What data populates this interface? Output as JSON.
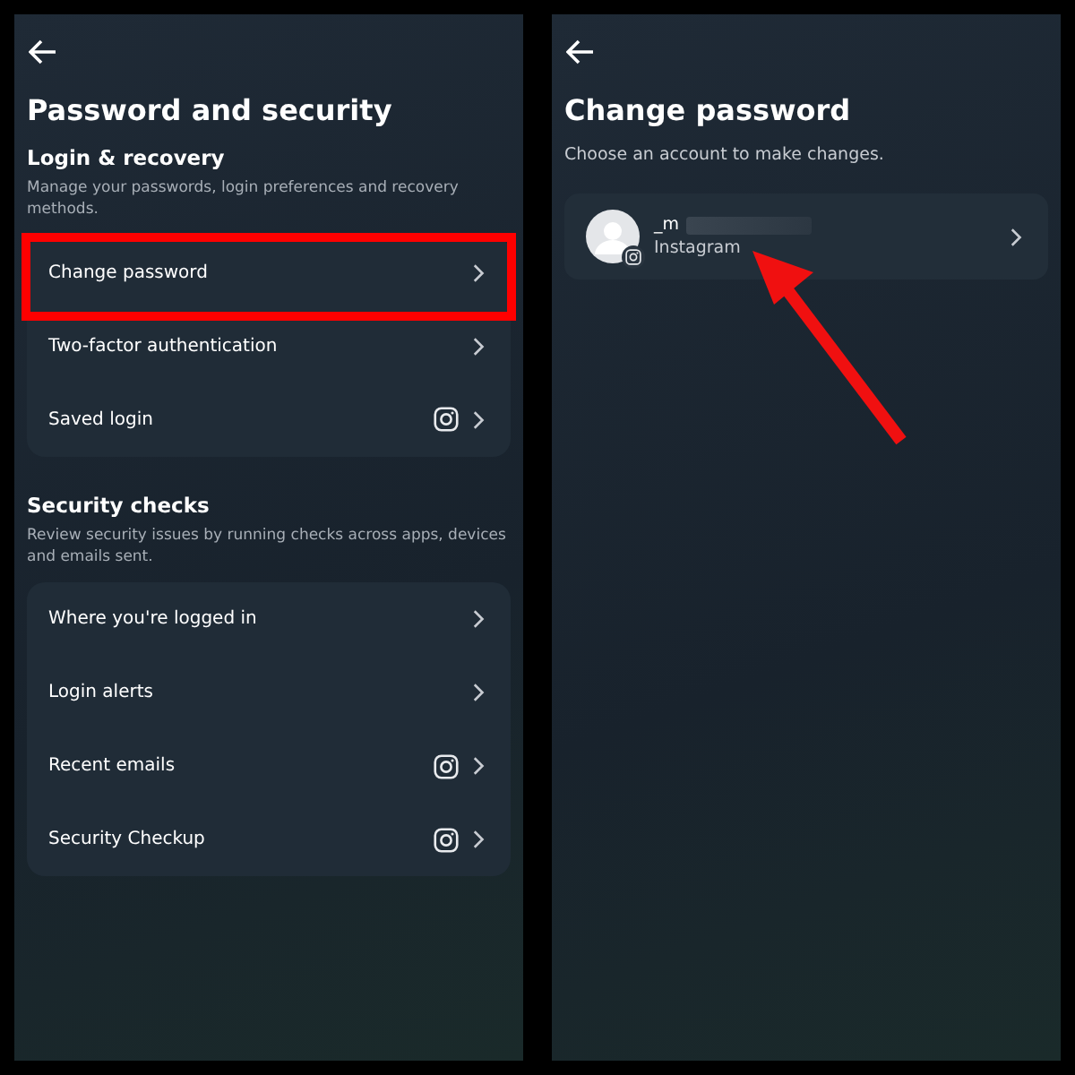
{
  "left_screen": {
    "title": "Password and security",
    "sections": [
      {
        "heading": "Login & recovery",
        "description": "Manage your passwords, login preferences and recovery methods.",
        "items": [
          {
            "label": "Change password",
            "instagram": false,
            "highlighted": true
          },
          {
            "label": "Two-factor authentication",
            "instagram": false,
            "highlighted": false
          },
          {
            "label": "Saved login",
            "instagram": true,
            "highlighted": false
          }
        ]
      },
      {
        "heading": "Security checks",
        "description": "Review security issues by running checks across apps, devices and emails sent.",
        "items": [
          {
            "label": "Where you're logged in",
            "instagram": false,
            "highlighted": false
          },
          {
            "label": "Login alerts",
            "instagram": false,
            "highlighted": false
          },
          {
            "label": "Recent emails",
            "instagram": true,
            "highlighted": false
          },
          {
            "label": "Security Checkup",
            "instagram": true,
            "highlighted": false
          }
        ]
      }
    ]
  },
  "right_screen": {
    "title": "Change password",
    "subtitle": "Choose an account to make changes.",
    "accounts": [
      {
        "username": "_m",
        "platform": "Instagram",
        "arrow_annotation": true
      }
    ]
  }
}
